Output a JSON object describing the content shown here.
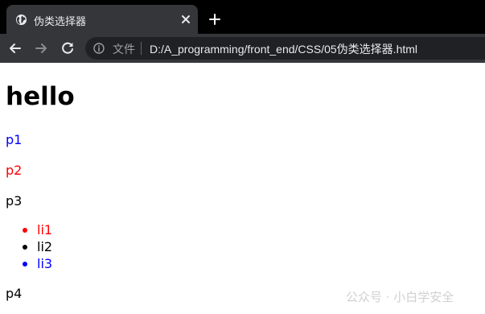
{
  "browser": {
    "tab": {
      "title": "伪类选择器",
      "favicon_icon": "globe-icon",
      "close_icon": "close-icon"
    },
    "new_tab_icon": "plus-icon",
    "nav": {
      "back_icon": "arrow-left-icon",
      "forward_icon": "arrow-right-icon",
      "reload_icon": "reload-icon"
    },
    "omnibox": {
      "info_icon": "info-icon",
      "security_label": "文件",
      "url": "D:/A_programming/front_end/CSS/05伪类选择器.html"
    },
    "colors": {
      "tabstrip": "#000000",
      "active_tab": "#35363a",
      "omnibox": "#202124"
    }
  },
  "page": {
    "heading": "hello",
    "paragraphs": [
      {
        "text": "p1",
        "color": "#0000ff"
      },
      {
        "text": "p2",
        "color": "#ff0000"
      },
      {
        "text": "p3",
        "color": "#000000"
      },
      {
        "text": "p4",
        "color": "#000000"
      }
    ],
    "list_items": [
      {
        "text": "li1",
        "color": "#ff0000"
      },
      {
        "text": "li2",
        "color": "#000000"
      },
      {
        "text": "li3",
        "color": "#0000ff"
      }
    ]
  },
  "watermark": "公众号 · 小白学安全"
}
